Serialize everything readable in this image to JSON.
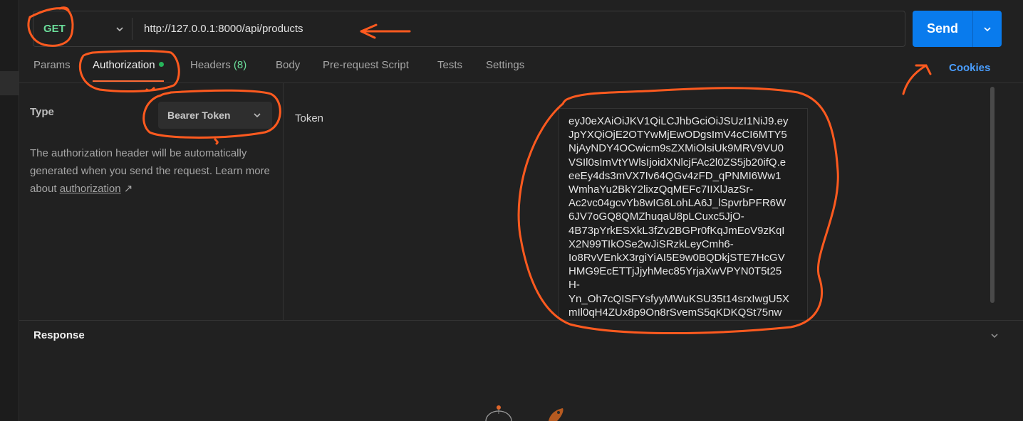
{
  "request": {
    "method": "GET",
    "url": "http://127.0.0.1:8000/api/products",
    "method_color": "#6bdd9a"
  },
  "send": {
    "label": "Send",
    "color": "#097bed"
  },
  "tabs": [
    {
      "label": "Params"
    },
    {
      "label": "Authorization",
      "active": true
    },
    {
      "label": "Headers",
      "count": "(8)"
    },
    {
      "label": "Body"
    },
    {
      "label": "Pre-request Script"
    },
    {
      "label": "Tests"
    },
    {
      "label": "Settings"
    }
  ],
  "cookies_label": "Cookies",
  "auth": {
    "type_label": "Type",
    "type_value": "Bearer Token",
    "help_text": "The authorization header will be automatically generated when you send the request. Learn more about",
    "help_link": "authorization",
    "help_arrow": "↗",
    "token_label": "Token",
    "token_lines": [
      "eyJ0eXAiOiJKV1QiLCJhbGciOiJSUzI1NiJ9.ey",
      "JpYXQiOjE2OTYwMjEwODgsImV4cCI6MTY5",
      "NjAyNDY4OCwicm9sZXMiOlsiUk9MRV9VU0",
      "VSIl0sImVtYWlsIjoidXNlcjFAc2l0ZS5jb20ifQ.e",
      "eeEy4ds3mVX7Iv64QGv4zFD_qPNMI6Ww1",
      "WmhaYu2BkY2lixzQqMEFc7IIXlJazSr-",
      "Ac2vc04gcvYb8wIG6LohLA6J_lSpvrbPFR6W",
      "6JV7oGQ8QMZhuqaU8pLCuxc5JjO-",
      "4B73pYrkESXkL3fZv2BGPr0fKqJmEoV9zKqI",
      "X2N99TIkOSe2wJiSRzkLeyCmh6-",
      "Io8RvVEnkX3rgiYiAI5E9w0BQDkjSTE7HcGV",
      "HMG9EcETTjJjyhMec85YrjaXwVPYN0T5t25",
      "H-",
      "Yn_Oh7cQISFYsfyyMWuKSU35t14srxIwgU5X",
      "mIl0qH4ZUx8p9On8rSvemS5qKDKQSt75nw"
    ]
  },
  "response_label": "Response",
  "annotation_color": "#ff5a1f",
  "icons": [
    "chevron-down-icon",
    "external-link-icon",
    "status-dot-icon"
  ]
}
